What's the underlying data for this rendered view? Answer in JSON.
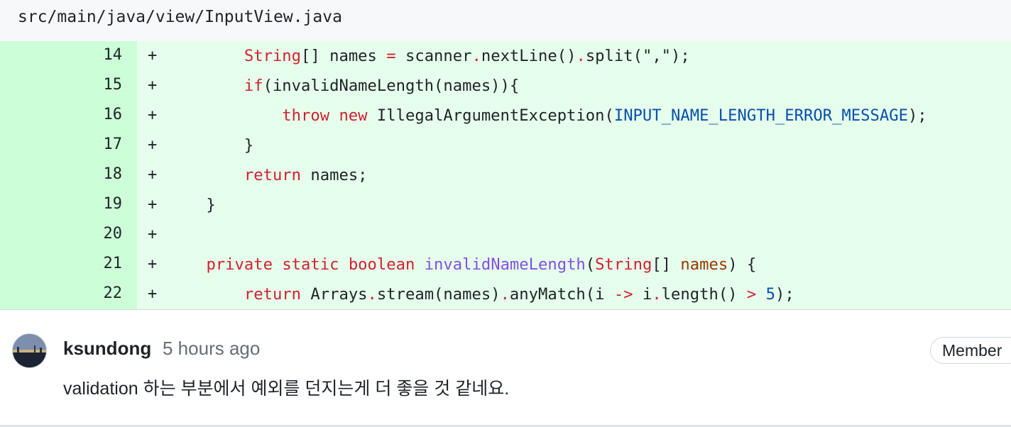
{
  "file": {
    "path": "src/main/java/view/InputView.java"
  },
  "diff": {
    "lines": [
      {
        "number": "14",
        "marker": "+"
      },
      {
        "number": "15",
        "marker": "+"
      },
      {
        "number": "16",
        "marker": "+"
      },
      {
        "number": "17",
        "marker": "+"
      },
      {
        "number": "18",
        "marker": "+"
      },
      {
        "number": "19",
        "marker": "+"
      },
      {
        "number": "20",
        "marker": "+"
      },
      {
        "number": "21",
        "marker": "+"
      },
      {
        "number": "22",
        "marker": "+"
      }
    ],
    "tokens": {
      "l14": [
        "        ",
        "String",
        "[] names ",
        "=",
        " scanner",
        ".",
        "nextLine()",
        ".",
        "split(\",\");"
      ],
      "l15": [
        "        ",
        "if",
        "(invalidNameLength(names)){"
      ],
      "l16": [
        "            ",
        "throw",
        " ",
        "new",
        " IllegalArgumentException(",
        "INPUT_NAME_LENGTH_ERROR_MESSAGE",
        ");"
      ],
      "l17": [
        "        }"
      ],
      "l18": [
        "        ",
        "return",
        " names;"
      ],
      "l19": [
        "    }"
      ],
      "l20": [
        ""
      ],
      "l21": [
        "    ",
        "private",
        " ",
        "static",
        " ",
        "boolean",
        " ",
        "invalidNameLength",
        "(",
        "String",
        "[] ",
        "names",
        ") {"
      ],
      "l22": [
        "        ",
        "return",
        " Arrays",
        ".",
        "stream(names)",
        ".",
        "anyMatch(i ",
        "->",
        " i",
        ".",
        "length() ",
        ">",
        " ",
        "5",
        ");"
      ]
    }
  },
  "comment": {
    "author": "ksundong",
    "time": "5 hours ago",
    "badge": "Member",
    "body": "validation 하는 부분에서 예외를 던지는게 더 좋을 것 같네요."
  },
  "colors": {
    "addition_bg": "#e6ffec",
    "addition_gutter": "#ccffd8",
    "keyword": "#cf222e",
    "function": "#8250df",
    "constant": "#0550ae"
  }
}
